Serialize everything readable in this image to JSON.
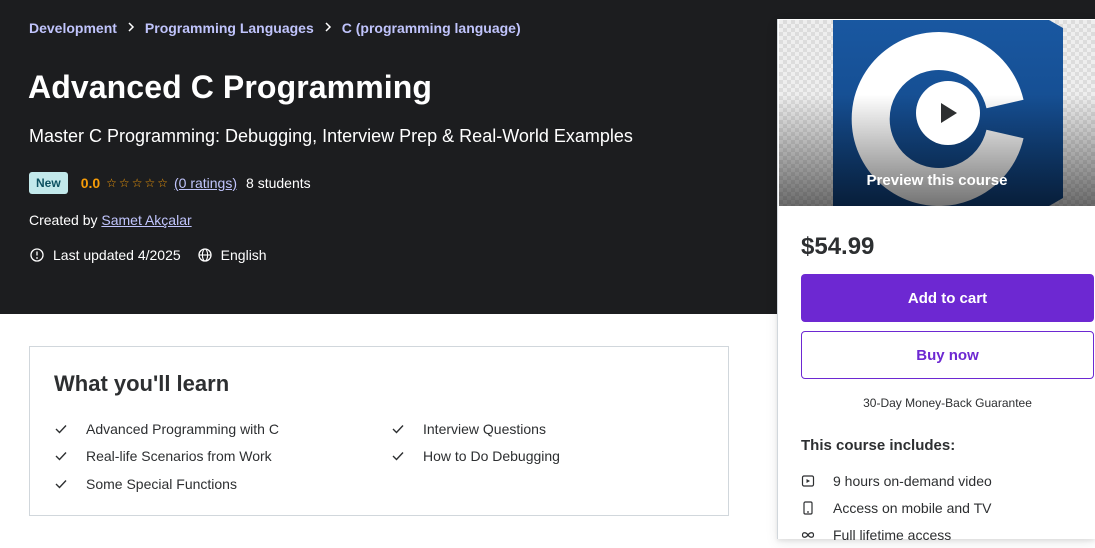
{
  "breadcrumb": [
    "Development",
    "Programming Languages",
    "C (programming language)"
  ],
  "course": {
    "title": "Advanced C Programming",
    "subtitle": "Master C Programming: Debugging, Interview Prep & Real-World Examples",
    "badge": "New",
    "rating": "0.0",
    "rating_stars": 0,
    "ratings_link": "(0 ratings)",
    "students": "8 students",
    "created_by_label": "Created by",
    "author": "Samet Akçalar",
    "last_updated": "Last updated 4/2025",
    "language": "English"
  },
  "sidebar": {
    "preview_label": "Preview this course",
    "price": "$54.99",
    "add_to_cart": "Add to cart",
    "buy_now": "Buy now",
    "guarantee": "30-Day Money-Back Guarantee",
    "includes_title": "This course includes:",
    "includes": [
      {
        "icon": "video-icon",
        "label": "9 hours on-demand video"
      },
      {
        "icon": "mobile-icon",
        "label": "Access on mobile and TV"
      },
      {
        "icon": "infinity-icon",
        "label": "Full lifetime access"
      }
    ]
  },
  "learn": {
    "title": "What you'll learn",
    "items": [
      "Advanced Programming with C",
      "Interview Questions",
      "Real-life Scenarios from Work",
      "How to Do Debugging",
      "Some Special Functions"
    ]
  },
  "colors": {
    "hero_bg": "#1c1d1f",
    "link": "#c0c4fc",
    "rating": "#f69c08",
    "primary": "#6d28d2",
    "badge_bg": "#c2e9eb"
  }
}
